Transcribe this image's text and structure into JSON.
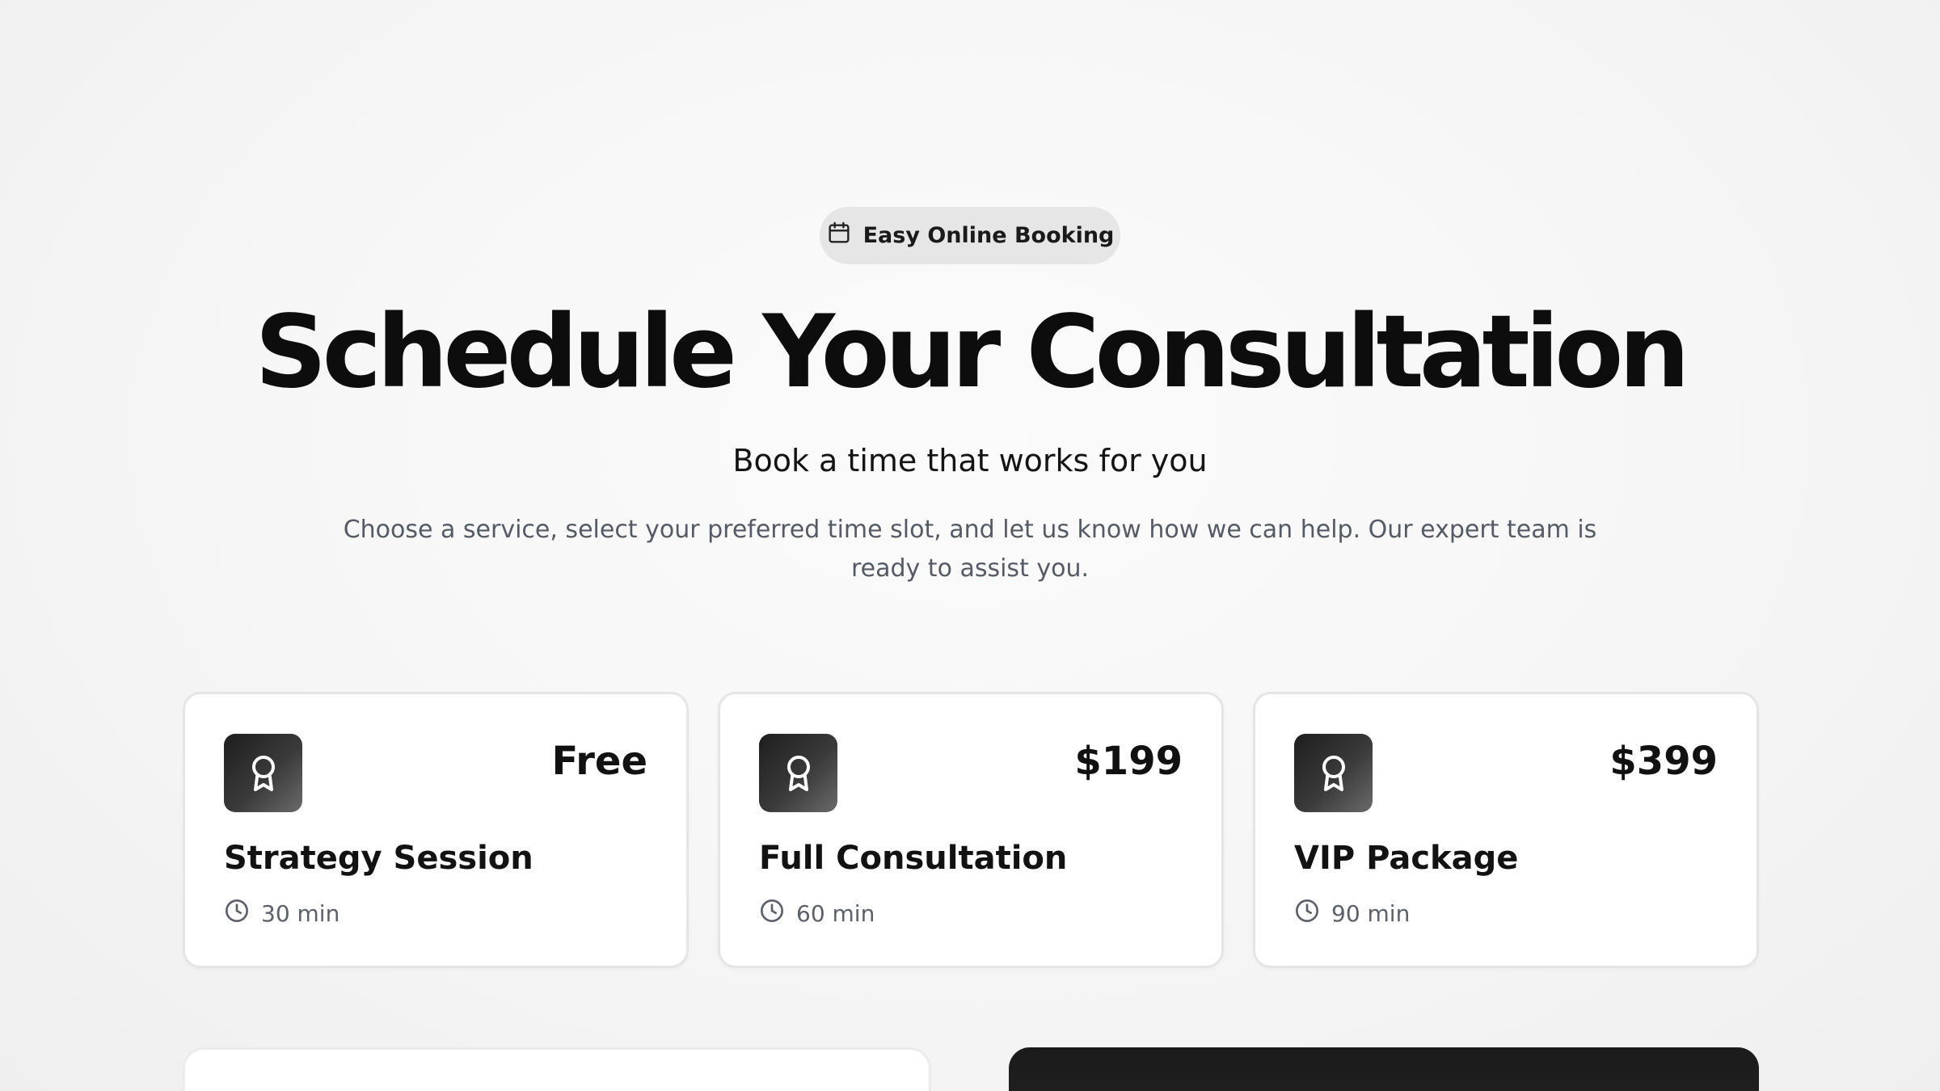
{
  "badge": {
    "icon": "calendar-icon",
    "label": "Easy Online Booking"
  },
  "hero": {
    "title": "Schedule Your Consultation",
    "subtitle": "Book a time that works for you",
    "description": "Choose a service, select your preferred time slot, and let us know how we can help. Our expert team is ready to assist you."
  },
  "services": [
    {
      "icon": "award-icon",
      "price": "Free",
      "title": "Strategy Session",
      "duration_icon": "clock-icon",
      "duration": "30 min"
    },
    {
      "icon": "award-icon",
      "price": "$199",
      "title": "Full Consultation",
      "duration_icon": "clock-icon",
      "duration": "60 min"
    },
    {
      "icon": "award-icon",
      "price": "$399",
      "title": "VIP Package",
      "duration_icon": "clock-icon",
      "duration": "90 min"
    }
  ],
  "colors": {
    "background": "#f7f7f7",
    "card": "#ffffff",
    "icon_tile_dark": "#1e1e1e",
    "dark_panel": "#1b1b1b",
    "muted_text": "#545b66"
  }
}
